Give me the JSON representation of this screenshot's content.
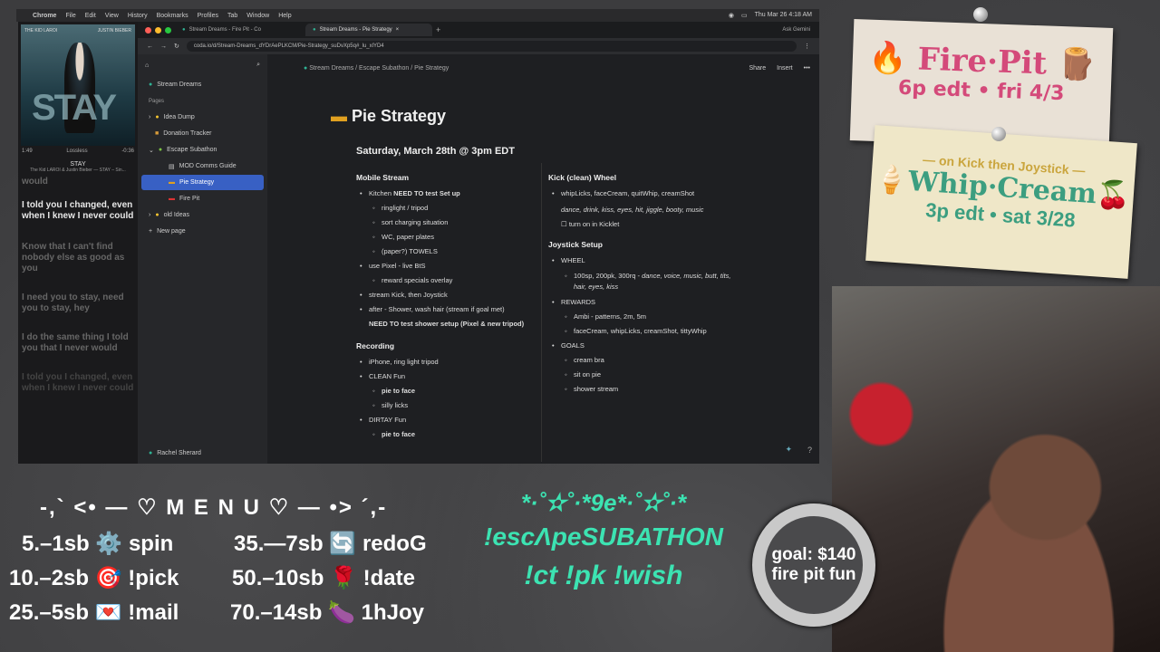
{
  "menubar": {
    "items": [
      "Chrome",
      "File",
      "Edit",
      "View",
      "History",
      "Bookmarks",
      "Profiles",
      "Tab",
      "Window",
      "Help"
    ],
    "datetime": "Thu Mar 26  4:18 AM"
  },
  "music": {
    "album_artist_left": "THE KID LAROI",
    "album_artist_right": "JUSTIN BIEBER",
    "album_text": "STAY",
    "time_elapsed": "1:49",
    "quality": "Lossless",
    "time_remaining": "-0:36",
    "song": "STAY",
    "artist": "The Kid LAROI & Justin Bieber — STAY – Sin...",
    "lyrics": [
      "would",
      "I told you I changed, even when I knew I never could",
      "Know that I can't find nobody else as good as you",
      "I need you to stay, need you to stay, hey",
      "I do the same thing I told you that I never would",
      "I told you I changed, even when I knew I never could"
    ]
  },
  "browser": {
    "tab1": "Stream Dreams - Fire Pit - Co",
    "tab2": "Stream Dreams - Pie Strategy",
    "url": "coda.io/d/Stream-Dreams_dYDrAePLKCM/Pie-Strategy_suDvXp5q#_lu_xlYD4",
    "ask": "Ask Gemini"
  },
  "sidebar": {
    "doc": "Stream Dreams",
    "pages_label": "Pages",
    "items": [
      {
        "label": "Idea Dump",
        "icon": "bulb-icon"
      },
      {
        "label": "Donation Tracker",
        "icon": "money-icon"
      },
      {
        "label": "Escape Subathon",
        "icon": "pin-icon"
      },
      {
        "label": "MOD Comms Guide",
        "icon": "doc-icon"
      },
      {
        "label": "Pie Strategy",
        "icon": "pie-icon"
      },
      {
        "label": "Fire Pit",
        "icon": "flag-icon"
      },
      {
        "label": "old Ideas",
        "icon": "bulb-icon"
      }
    ],
    "new_page": "New page",
    "user": "Rachel Sherard"
  },
  "doc": {
    "breadcrumb": [
      "Stream Dreams",
      "Escape Subathon",
      "Pie Strategy"
    ],
    "share": "Share",
    "insert": "Insert",
    "title": "Pie Strategy",
    "date": "Saturday, March 28th @ 3pm EDT",
    "mobile_h": "Mobile Stream",
    "kitchen_pre": "Kitchen ",
    "kitchen_bold": "NEED TO test Set up",
    "kitchen_subs": [
      "ringlight / tripod",
      "sort charging situation",
      "WC, paper plates",
      "(paper?) TOWELS"
    ],
    "pixel": "use Pixel - live BtS",
    "pixel_sub": "reward specials overlay",
    "stream_kick": "stream Kick, then Joystick",
    "after": "after - Shower, wash hair (stream if goal met)",
    "need_shower": "NEED TO test shower setup (Pixel & new tripod)",
    "recording_h": "Recording",
    "rec1": "iPhone, ring light tripod",
    "clean": "CLEAN Fun",
    "pie_face": "pie to face",
    "silly": "silly licks",
    "dirty": "DIRTAY Fun",
    "pie_face2": "pie to face",
    "kick_h": "Kick (clean) Wheel",
    "kick_line1": "whipLicks, faceCream, quitWhip, creamShot",
    "kick_line2": "dance, drink, kiss, eyes, hit, jiggle, booty, music",
    "kick_check": "turn on in  Kicklet",
    "joy_h": "Joystick Setup",
    "wheel": "WHEEL",
    "wheel_sub_plain": "100sp, 200pk, 300rq - ",
    "wheel_sub_italic": "dance, voice, music, butt, tits, hair, eyes, kiss",
    "rewards": "REWARDS",
    "rew1": "Ambi - patterns, 2m, 5m",
    "rew2": "faceCream, whipLicks, creamShot, tittyWhip",
    "goals": "GOALS",
    "g1": "cream bra",
    "g2": "sit on pie",
    "g3": "shower stream"
  },
  "firepit": {
    "title": "Fire·Pit",
    "sub": "6p edt • fri 4/3"
  },
  "whip": {
    "top": "— on Kick then Joystick —",
    "title": "Whip·Cream",
    "sub": "3p edt • sat 3/28"
  },
  "menu": {
    "title": "-,` <• — ♡ M E N U ♡ — •> ´,-",
    "left": [
      "5.–1sb ⚙️ spin",
      "10.–2sb 🎯 !pick",
      "25.–5sb 💌 !mail"
    ],
    "right": [
      "35.—7sb 🔄 redoG",
      "50.–10sb 🌹 !date",
      "70.–14sb 🍆 1hJoy"
    ]
  },
  "escape": {
    "line1": "*·˚✫˚·*9e*·˚✫˚·*",
    "line2": "!escΛpeSUBATHON",
    "line3": "!ct !pk !wish"
  },
  "goal": {
    "line1": "goal: $140",
    "line2": "fire pit fun"
  }
}
